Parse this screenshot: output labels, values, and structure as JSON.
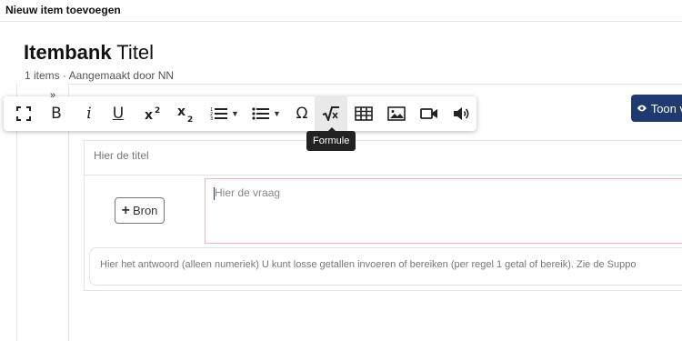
{
  "header": {
    "title": "Nieuw item toevoegen"
  },
  "itembank": {
    "title_bold": "Itembank",
    "title_rest": " Titel",
    "subtitle": "1 items · Aangemaakt door NN"
  },
  "toolbar": {
    "more_glyph": "»",
    "buttons": [
      {
        "name": "fullscreen",
        "icon": "fullscreen-icon"
      },
      {
        "name": "bold",
        "icon": "bold-icon",
        "text": "B"
      },
      {
        "name": "italic",
        "icon": "italic-icon",
        "text": "i"
      },
      {
        "name": "underline",
        "icon": "underline-icon",
        "text": "U"
      },
      {
        "name": "superscript",
        "icon": "superscript-icon"
      },
      {
        "name": "subscript",
        "icon": "subscript-icon"
      },
      {
        "name": "ordered-list",
        "icon": "ordered-list-icon"
      },
      {
        "name": "unordered-list",
        "icon": "unordered-list-icon"
      },
      {
        "name": "special-characters",
        "icon": "omega-icon",
        "text": "Ω"
      },
      {
        "name": "formula",
        "icon": "square-root-icon",
        "active": true
      },
      {
        "name": "table",
        "icon": "table-icon"
      },
      {
        "name": "image",
        "icon": "image-icon"
      },
      {
        "name": "video",
        "icon": "video-icon"
      },
      {
        "name": "audio",
        "icon": "speaker-icon"
      }
    ],
    "tooltip": "Formule"
  },
  "show_button": {
    "label": "Toon v",
    "icon": "eye-icon",
    "color": "#1e3a6e"
  },
  "form": {
    "title_placeholder": "Hier de titel",
    "bron_label": "Bron",
    "question_placeholder": "Hier de vraag",
    "answer_placeholder": "Hier het antwoord (alleen numeriek) U kunt losse getallen invoeren of bereiken (per regel 1 getal of bereik). Zie de Suppo"
  }
}
